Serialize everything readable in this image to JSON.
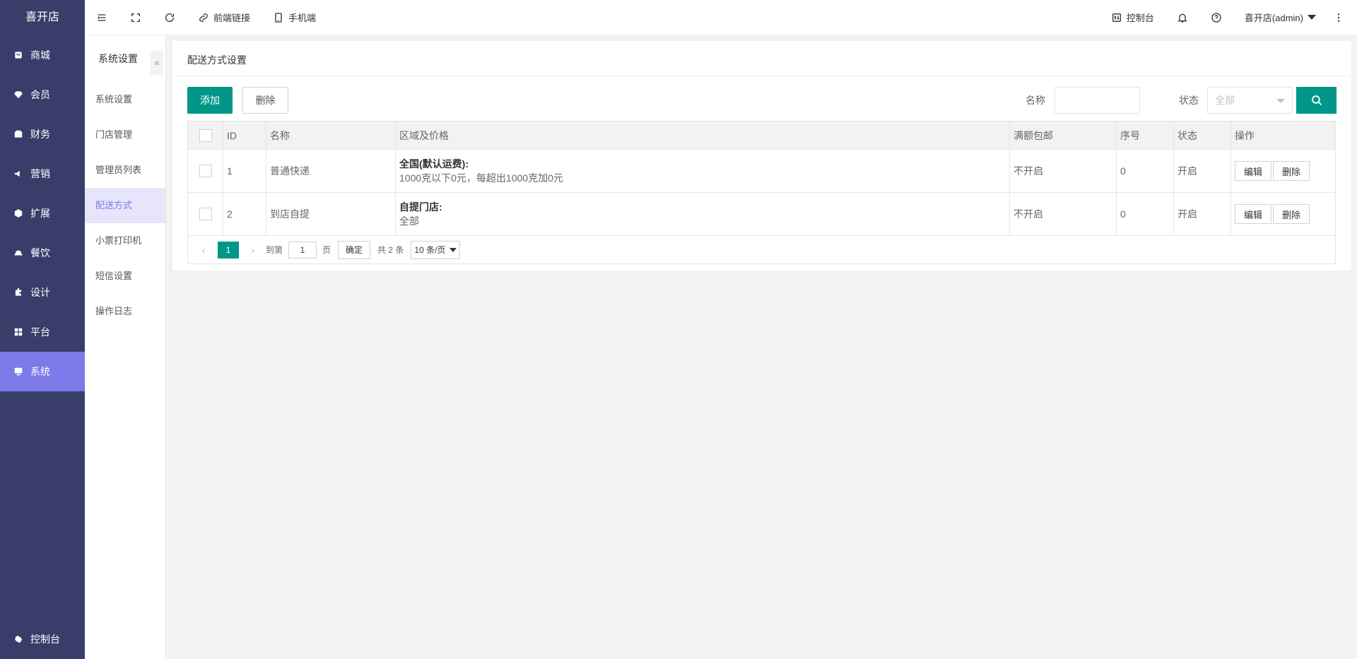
{
  "brand": "喜开店",
  "nav": [
    {
      "label": "商城",
      "icon": "shop-icon",
      "active": false
    },
    {
      "label": "会员",
      "icon": "gem-icon",
      "active": false
    },
    {
      "label": "财务",
      "icon": "wallet-icon",
      "active": false
    },
    {
      "label": "营销",
      "icon": "megaphone-icon",
      "active": false
    },
    {
      "label": "扩展",
      "icon": "cube-icon",
      "active": false
    },
    {
      "label": "餐饮",
      "icon": "dish-icon",
      "active": false
    },
    {
      "label": "设计",
      "icon": "puzzle-icon",
      "active": false
    },
    {
      "label": "平台",
      "icon": "grid-icon",
      "active": false
    },
    {
      "label": "系统",
      "icon": "monitor-icon",
      "active": true
    }
  ],
  "nav_bottom": {
    "label": "控制台",
    "icon": "gear-icon"
  },
  "subnav": {
    "title": "系统设置",
    "collapse": "«",
    "items": [
      "系统设置",
      "门店管理",
      "管理员列表",
      "配送方式",
      "小票打印机",
      "短信设置",
      "操作日志"
    ],
    "active_index": 3
  },
  "topbar": {
    "front_link": "前端链接",
    "mobile": "手机端",
    "console": "控制台",
    "user": "喜开店(admin)"
  },
  "page": {
    "title": "配送方式设置",
    "add_btn": "添加",
    "delete_btn": "删除",
    "filter_name_label": "名称",
    "filter_status_label": "状态",
    "filter_status_value": "全部"
  },
  "table": {
    "headers": [
      "ID",
      "名称",
      "区域及价格",
      "满额包邮",
      "序号",
      "状态",
      "操作"
    ],
    "rows": [
      {
        "id": "1",
        "name": "普通快递",
        "region_title": "全国(默认运费):",
        "region_desc": "1000克以下0元，每超出1000克加0元",
        "free": "不开启",
        "order": "0",
        "status": "开启",
        "edit": "编辑",
        "del": "删除"
      },
      {
        "id": "2",
        "name": "到店自提",
        "region_title": "自提门店:",
        "region_desc": "全部",
        "free": "不开启",
        "order": "0",
        "status": "开启",
        "edit": "编辑",
        "del": "删除"
      }
    ]
  },
  "pager": {
    "current": "1",
    "goto_label": "到第",
    "goto_value": "1",
    "page_label": "页",
    "confirm": "确定",
    "total": "共 2 条",
    "per_page": "10 条/页"
  }
}
